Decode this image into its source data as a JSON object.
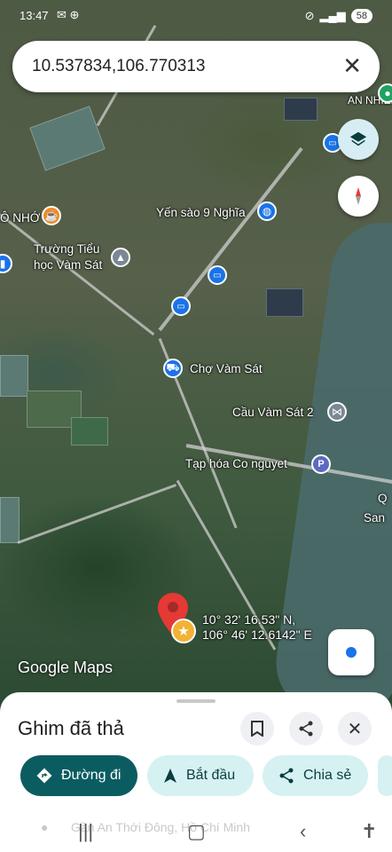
{
  "status": {
    "time": "13:47",
    "battery": "58"
  },
  "search": {
    "query": "10.537834,106.770313"
  },
  "map_labels": {
    "an_nhien": "AN NHIÊN",
    "yen_sao": "Yến sào 9 Nghĩa",
    "o_nho": "Ô NHỚ",
    "truong_line1": "Trường Tiểu",
    "truong_line2": "học Vàm Sát",
    "cho": "Chợ Vàm Sát",
    "cau": "Cầu Vàm Sát 2",
    "tap_hoa": "Tạp hóa Co nguyet",
    "qsan_line1": "Q",
    "qsan_line2": "San"
  },
  "pin_coordinates": {
    "lat": "10° 32' 16.53\" N,",
    "lng": "106° 46' 12.6142\" E"
  },
  "watermark": "Google Maps",
  "sheet": {
    "title": "Ghim đã thả",
    "actions": [
      {
        "label": "Đường đi",
        "icon": "directions-icon"
      },
      {
        "label": "Bắt đầu",
        "icon": "navigation-arrow-icon"
      },
      {
        "label": "Chia sẻ",
        "icon": "share-icon"
      }
    ]
  },
  "bottom_address": "Gần An Thới Đông, Hồ Chí Minh",
  "colors": {
    "primary": "#0b5c61",
    "secondary": "#d6f1f1",
    "pin": "#e53935",
    "locate_dot": "#1a73e8"
  }
}
